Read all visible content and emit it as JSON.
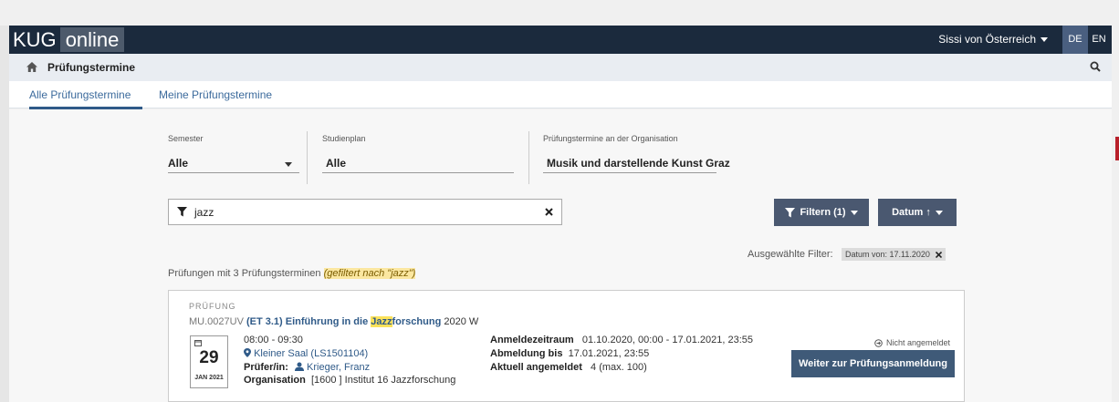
{
  "header": {
    "logo_kug": "KUG",
    "logo_online": "online",
    "user_name": "Sissi von Österreich",
    "lang_de": "DE",
    "lang_en": "EN"
  },
  "subbar": {
    "title": "Prüfungstermine"
  },
  "tabs": [
    {
      "label": "Alle Prüfungstermine",
      "active": true
    },
    {
      "label": "Meine Prüfungstermine",
      "active": false
    }
  ],
  "filters": {
    "semester_label": "Semester",
    "semester_value": "Alle",
    "studienplan_label": "Studienplan",
    "studienplan_value": "Alle",
    "org_label": "Prüfungstermine an der Organisation",
    "org_value": "Musik und darstellende Kunst Graz"
  },
  "search": {
    "value": "jazz"
  },
  "buttons": {
    "filter_label": "Filtern (1)",
    "sort_label": "Datum ↑"
  },
  "selected_filter": {
    "label": "Ausgewählte Filter:",
    "chip": "Datum von: 17.11.2020"
  },
  "results": {
    "prefix": "Prüfungen mit 3 Prüfungsterminen",
    "filter_note": "(gefiltert nach \"jazz\")"
  },
  "card": {
    "type": "PRÜFUNG",
    "code": "MU.0027UV",
    "title_before": "(ET 3.1) Einführung in die ",
    "title_highlight": "Jazz",
    "title_after": "forschung",
    "semester": "2020 W",
    "day": "29",
    "month_year": "JAN 2021",
    "time": "08:00 - 09:30",
    "location": "Kleiner Saal (LS1501104)",
    "examiner_label": "Prüfer/in:",
    "examiner": "Krieger, Franz",
    "org_label": "Organisation",
    "org_value": "[1600 ] Institut 16 Jazzforschung",
    "reg_period_label": "Anmeldezeitraum",
    "reg_period_value": "01.10.2020, 00:00 - 17.01.2021, 23:55",
    "dereg_label": "Abmeldung bis",
    "dereg_value": "17.01.2021, 23:55",
    "current_label": "Aktuell angemeldet",
    "current_value": "4 (max. 100)",
    "status": "Nicht angemeldet",
    "register_button": "Weiter zur Prüfungsanmeldung"
  }
}
